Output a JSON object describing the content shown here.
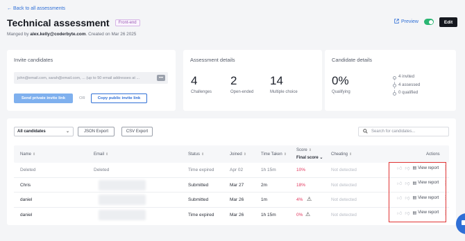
{
  "nav": {
    "back_label": "← Back to all assessments"
  },
  "header": {
    "title": "Technical assessment",
    "tag": "Front-end",
    "subtitle_prefix": "Manged by ",
    "manager": "alex.kelly@coderbyte.com",
    "subtitle_suffix": ". Created on Mar 26 2025",
    "preview_label": "Preview",
    "edit_label": "Edit",
    "toggle_on": true
  },
  "invite": {
    "title": "Invite candidates",
    "placeholder": "john@email.com, sarah@email.com, ... (up to 50 email addresses at ...",
    "more_label": "•••",
    "send_label": "Send private invite link",
    "or_label": "OR",
    "copy_label": "Copy public invite link"
  },
  "assessment": {
    "title": "Assessment details",
    "stats": [
      {
        "value": "4",
        "label": "Challenges"
      },
      {
        "value": "2",
        "label": "Open-ended"
      },
      {
        "value": "14",
        "label": "Multiple choice"
      }
    ]
  },
  "candidates": {
    "title": "Candidate details",
    "percent": "0%",
    "percent_label": "Qualifying",
    "list": [
      "4 invited",
      "4 assessed",
      "0 qualified"
    ]
  },
  "table": {
    "filter_label": "All candidates",
    "json_export": "JSON Export",
    "csv_export": "CSV Export",
    "search_placeholder": "Search for candidates...",
    "columns": {
      "name": "Name",
      "email": "Email",
      "status": "Status",
      "joined": "Joined",
      "time_taken": "Time Taken",
      "score": "Score",
      "score_sub": "Final score",
      "cheating": "Cheating",
      "actions": "Actions"
    },
    "view_report_label": "View report",
    "rows": [
      {
        "name": "Deleted",
        "email": "Deleted",
        "status": "Time expired",
        "joined": "Apr 02",
        "time": "1h 15m",
        "score": "10%",
        "cheating": "Not detected",
        "muted": true,
        "warn": false
      },
      {
        "name": "Chris",
        "email": "",
        "status": "Submitted",
        "joined": "Mar 27",
        "time": "2m",
        "score": "18%",
        "cheating": "Not detected",
        "muted": false,
        "warn": false
      },
      {
        "name": "daniel",
        "email": "",
        "status": "Submitted",
        "joined": "Mar 26",
        "time": "1m",
        "score": "4%",
        "cheating": "Not detected",
        "muted": false,
        "warn": true
      },
      {
        "name": "daniel",
        "email": "",
        "status": "Time expired",
        "joined": "Mar 26",
        "time": "1h 15m",
        "score": "0%",
        "cheating": "Not detected",
        "muted": false,
        "warn": true
      }
    ]
  }
}
